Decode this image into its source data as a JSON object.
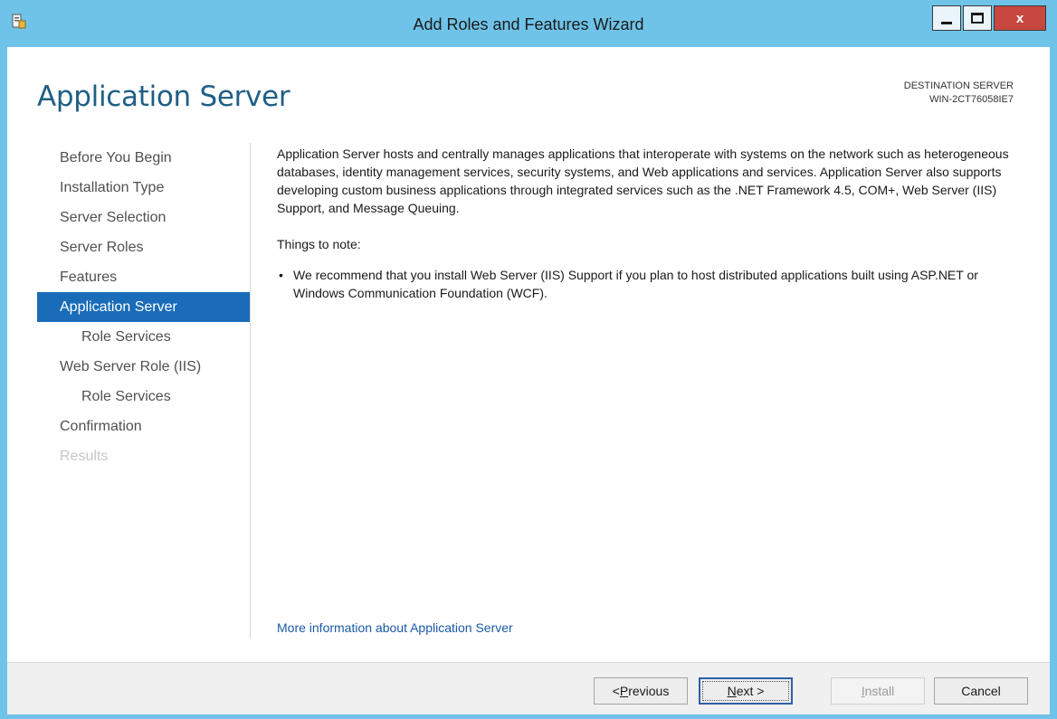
{
  "window": {
    "title": "Add Roles and Features Wizard",
    "buttons": {
      "minimize": "",
      "maximize": "",
      "close": "x"
    }
  },
  "header": {
    "page_title": "Application Server",
    "destination_label": "DESTINATION SERVER",
    "destination_server": "WIN-2CT76058IE7"
  },
  "nav": {
    "items": [
      {
        "label": "Before You Begin",
        "state": "normal",
        "level": 0
      },
      {
        "label": "Installation Type",
        "state": "normal",
        "level": 0
      },
      {
        "label": "Server Selection",
        "state": "normal",
        "level": 0
      },
      {
        "label": "Server Roles",
        "state": "normal",
        "level": 0
      },
      {
        "label": "Features",
        "state": "normal",
        "level": 0
      },
      {
        "label": "Application Server",
        "state": "active",
        "level": 0
      },
      {
        "label": "Role Services",
        "state": "normal",
        "level": 1
      },
      {
        "label": "Web Server Role (IIS)",
        "state": "normal",
        "level": 0
      },
      {
        "label": "Role Services",
        "state": "normal",
        "level": 1
      },
      {
        "label": "Confirmation",
        "state": "normal",
        "level": 0
      },
      {
        "label": "Results",
        "state": "disabled",
        "level": 0
      }
    ]
  },
  "main": {
    "description": "Application Server hosts and centrally manages applications that interoperate with systems on the network such as heterogeneous databases, identity management services, security systems, and Web applications and services. Application Server also supports developing custom business applications through integrated services such as the .NET Framework 4.5, COM+, Web Server (IIS) Support, and Message Queuing.",
    "notes_heading": "Things to note:",
    "notes": [
      "We recommend that you install Web Server (IIS) Support if you plan to host distributed applications built using ASP.NET or Windows Communication Foundation (WCF)."
    ],
    "more_info_link": "More information about Application Server"
  },
  "footer": {
    "previous": {
      "prefix": "< ",
      "mnemonic": "P",
      "rest": "revious"
    },
    "next": {
      "mnemonic": "N",
      "rest": "ext >"
    },
    "install": {
      "mnemonic": "I",
      "rest": "nstall"
    },
    "cancel": "Cancel"
  },
  "colors": {
    "frame": "#6fc3e8",
    "active_nav": "#1a6cb8",
    "title_blue": "#1f5f86",
    "link": "#1a5aa6",
    "close_button": "#c7483f"
  }
}
